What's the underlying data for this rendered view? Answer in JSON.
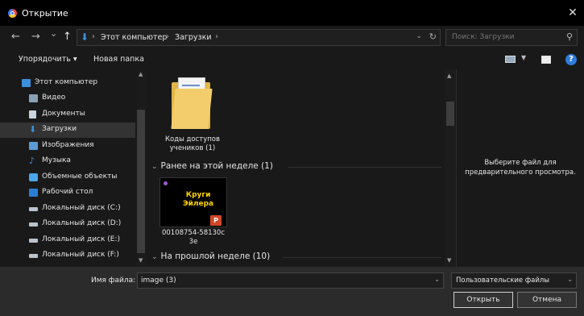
{
  "window": {
    "title": "Открытие",
    "close_glyph": "✕"
  },
  "nav": {
    "back_glyph": "←",
    "forward_glyph": "→",
    "recent_glyph": "⌄",
    "up_glyph": "↑",
    "breadcrumb": [
      "Этот компьютер",
      "Загрузки"
    ],
    "search_placeholder": "Поиск: Загрузки"
  },
  "toolbar": {
    "organize": "Упорядочить ▾",
    "new_folder": "Новая папка",
    "help": "?"
  },
  "sidebar": {
    "items": [
      {
        "label": "Этот компьютер",
        "icon": "computer-icon",
        "color": "#3c8fdc"
      },
      {
        "label": "Видео",
        "icon": "video-icon",
        "color": "#8aa0b8"
      },
      {
        "label": "Документы",
        "icon": "document-icon",
        "color": "#c8d4e0"
      },
      {
        "label": "Загрузки",
        "icon": "download-icon",
        "color": "#3c8fdc"
      },
      {
        "label": "Изображения",
        "icon": "pictures-icon",
        "color": "#5b9bd5"
      },
      {
        "label": "Музыка",
        "icon": "music-icon",
        "color": "#3c8fdc"
      },
      {
        "label": "Объемные объекты",
        "icon": "3d-objects-icon",
        "color": "#4aa8e8"
      },
      {
        "label": "Рабочий стол",
        "icon": "desktop-icon",
        "color": "#2a7fd4"
      },
      {
        "label": "Локальный диск (C:)",
        "icon": "drive-icon",
        "color": "#b8c4cf"
      },
      {
        "label": "Локальный диск (D:)",
        "icon": "drive-icon",
        "color": "#b8c4cf"
      },
      {
        "label": "Локальный диск (E:)",
        "icon": "drive-icon",
        "color": "#b8c4cf"
      },
      {
        "label": "Локальный диск (F:)",
        "icon": "drive-icon",
        "color": "#b8c4cf"
      }
    ]
  },
  "main": {
    "folder": {
      "label_line1": "Коды доступов",
      "label_line2": "учеников (1)"
    },
    "groups": [
      {
        "label": "Ранее на этой неделе (1)"
      },
      {
        "label": "На прошлой неделе (10)"
      }
    ],
    "file": {
      "thumb_title_line1": "Круги",
      "thumb_title_line2": "Эйлера",
      "badge": "P",
      "label_line1": "00108754-58130c",
      "label_line2": "3e"
    }
  },
  "preview": {
    "text": "Выберите файл для предварительного просмотра."
  },
  "bottom": {
    "filename_label": "Имя файла:",
    "filename_value": "image (3)",
    "filetype_value": "Пользовательские файлы",
    "open_label": "Открыть",
    "cancel_label": "Отмена"
  }
}
